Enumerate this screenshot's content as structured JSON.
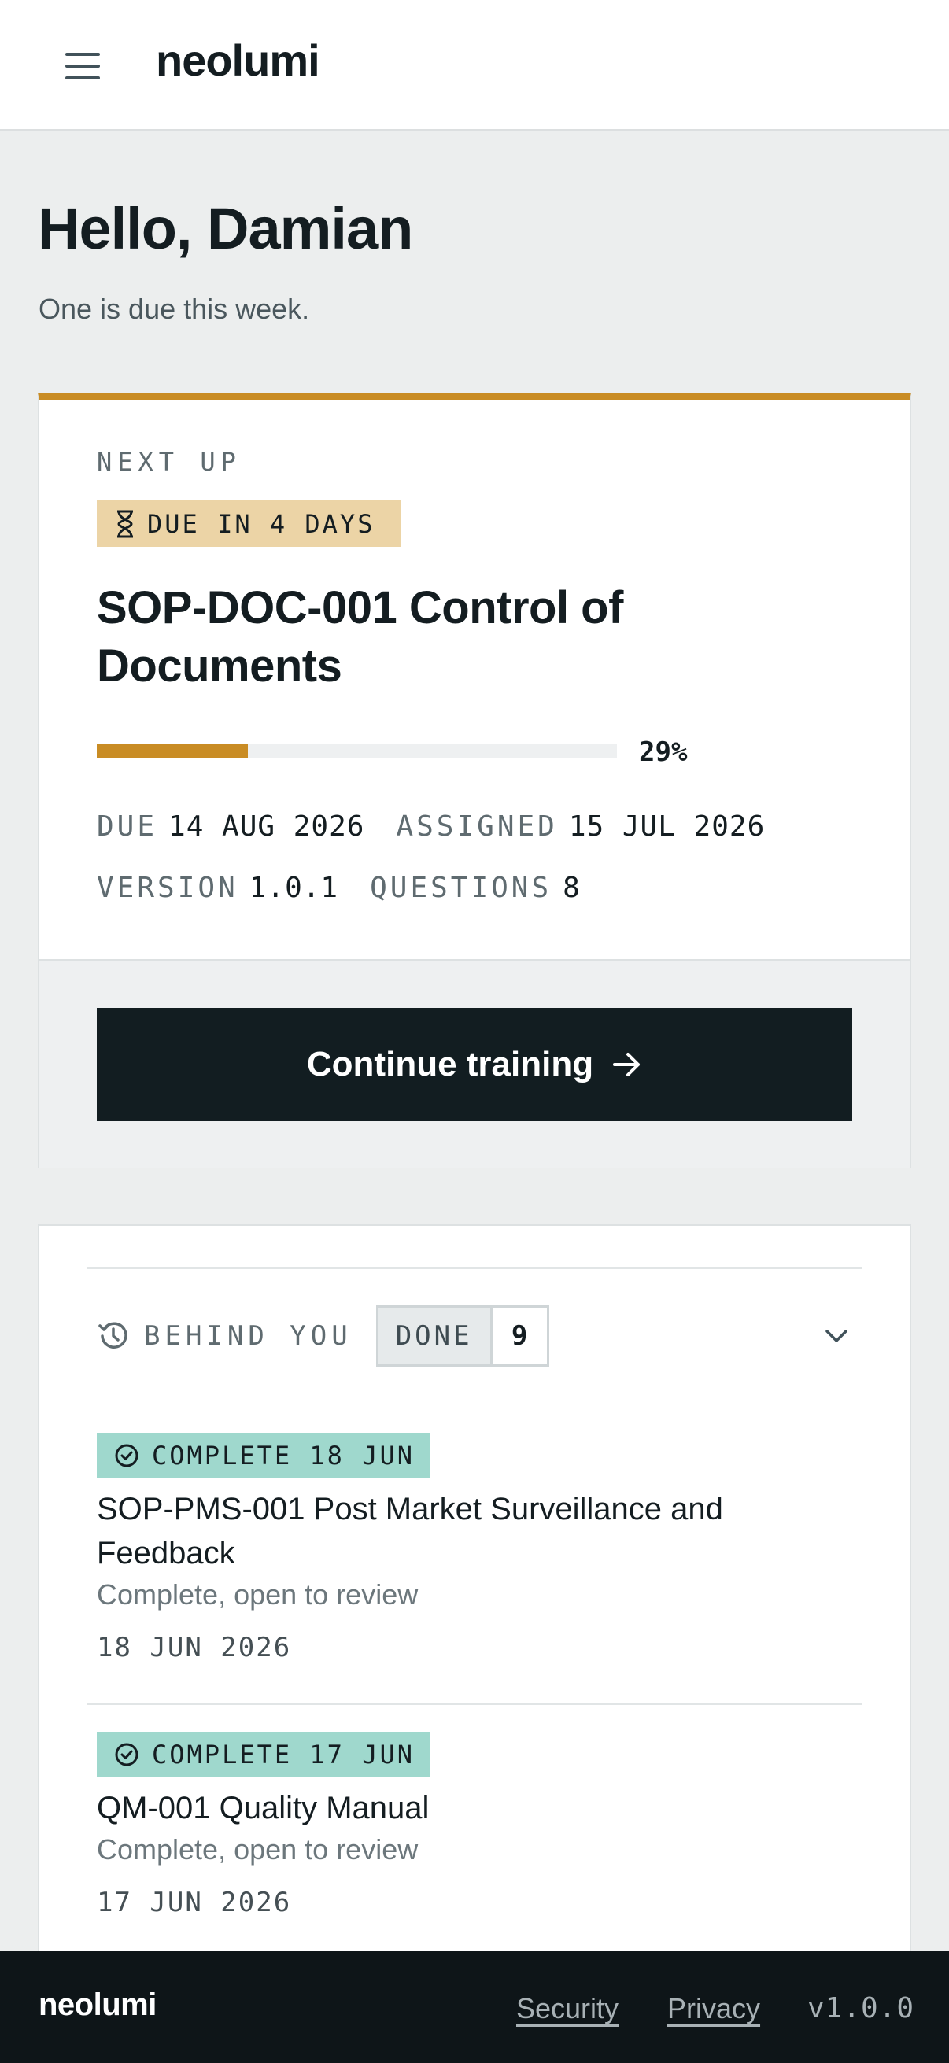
{
  "header": {
    "logo": "neolumi",
    "menu_icon": "hamburger-menu-icon"
  },
  "greeting": {
    "title": "Hello, Damian",
    "subtitle": "One is due this week."
  },
  "next_up": {
    "eyebrow": "NEXT UP",
    "due_badge": "DUE IN 4 DAYS",
    "title": "SOP-DOC-001 Control of Documents",
    "progress_percent": 29,
    "progress_label": "29%",
    "due_label": "DUE",
    "due_value": "14 AUG 2026",
    "assigned_label": "ASSIGNED",
    "assigned_value": "15 JUL 2026",
    "version_label": "VERSION",
    "version_value": "1.0.1",
    "questions_label": "QUESTIONS",
    "questions_value": "8",
    "cta": "Continue training"
  },
  "behind": {
    "label": "BEHIND YOU",
    "done_label": "DONE",
    "done_count": "9",
    "items": [
      {
        "badge": "COMPLETE 18 JUN",
        "title": "SOP-PMS-001 Post Market Surveillance and Feedback",
        "subtitle": "Complete, open to review",
        "date": "18 JUN 2026"
      },
      {
        "badge": "COMPLETE 17 JUN",
        "title": "QM-001 Quality Manual",
        "subtitle": "Complete, open to review",
        "date": "17 JUN 2026"
      }
    ]
  },
  "footer": {
    "logo": "neolumi",
    "links": [
      "Security",
      "Privacy"
    ],
    "version": "v1.0.0"
  },
  "colors": {
    "accent": "#c98c24",
    "due_badge": "#ecd4a6",
    "complete_badge": "#9fd8cd",
    "dark": "#121d21"
  }
}
